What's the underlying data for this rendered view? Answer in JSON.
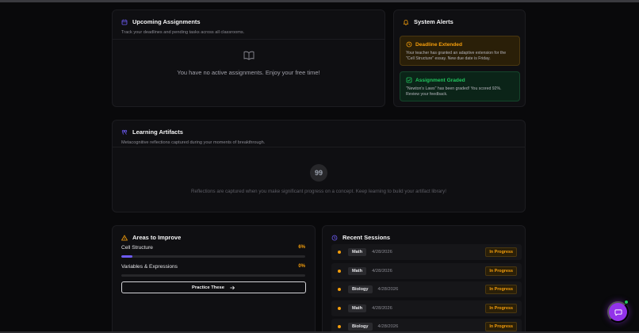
{
  "colors": {
    "background": "#09090b",
    "card": "#0f0f12",
    "accent_purple": "#6d5bf5",
    "warning": "#f59e0b",
    "success": "#22c55e",
    "fab": "#9333ea"
  },
  "assignments": {
    "icon": "calendar-icon",
    "title": "Upcoming Assignments",
    "subtitle": "Track your deadlines and pending tasks across all classrooms.",
    "empty_icon": "book-open-icon",
    "empty_text": "You have no active assignments. Enjoy your free time!"
  },
  "alerts": {
    "icon": "bell-icon",
    "title": "System Alerts",
    "items": [
      {
        "icon": "clock-icon",
        "title": "Deadline Extended",
        "text": "Your teacher has granted an adaptive extension for the \"Cell Structure\" essay. New due date is Friday."
      },
      {
        "icon": "check-square-icon",
        "title": "Assignment Graded",
        "text": "\"Newton's Laws\" has been graded! You scored 92%. Review your feedback."
      }
    ]
  },
  "artifacts": {
    "icon": "sparkle-icon",
    "title": "Learning Artifacts",
    "subtitle": "Metacognitive reflections captured during your moments of breakthrough.",
    "empty_icon": "quote-icon",
    "quote_glyph": "99",
    "empty_text": "Reflections are captured when you make significant progress on a concept. Keep learning to build your artifact library!"
  },
  "areas": {
    "icon": "warning-triangle-icon",
    "title": "Areas to Improve",
    "skills": [
      {
        "name": "Cell Structure",
        "percent_label": "6%",
        "progress": 0.06
      },
      {
        "name": "Variables & Expressions",
        "percent_label": "0%",
        "progress": 0.0
      }
    ],
    "button_label": "Practice These",
    "button_icon": "arrow-right-icon"
  },
  "sessions": {
    "icon": "clock-icon",
    "title": "Recent Sessions",
    "items": [
      {
        "subject": "Math",
        "date": "4/28/2026",
        "status": "In Progress"
      },
      {
        "subject": "Math",
        "date": "4/28/2026",
        "status": "In Progress"
      },
      {
        "subject": "Biology",
        "date": "4/28/2026",
        "status": "In Progress"
      },
      {
        "subject": "Math",
        "date": "4/28/2026",
        "status": "In Progress"
      },
      {
        "subject": "Biology",
        "date": "4/28/2026",
        "status": "In Progress"
      }
    ]
  },
  "chat": {
    "icon": "chat-bubble-icon"
  }
}
